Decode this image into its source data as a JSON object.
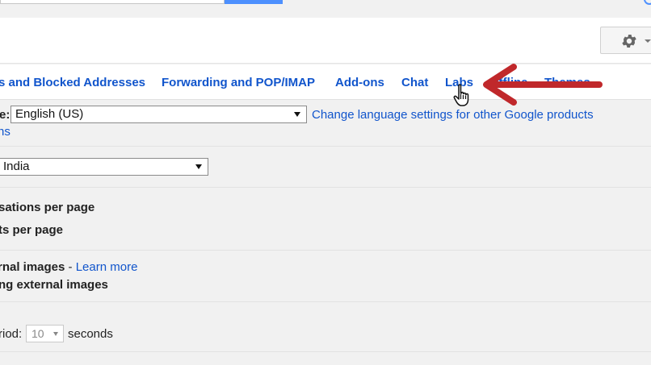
{
  "tabs": [
    {
      "label": "s and Blocked Addresses"
    },
    {
      "label": "Forwarding and POP/IMAP"
    },
    {
      "label": "Add-ons"
    },
    {
      "label": "Chat"
    },
    {
      "label": "Labs"
    },
    {
      "label": "Offline"
    },
    {
      "label": "Themes"
    }
  ],
  "language": {
    "label": "e:",
    "selected": "English (US)",
    "change_link": "Change language settings for other Google products",
    "second_line": "ns"
  },
  "country": {
    "selected": "India"
  },
  "page_size": {
    "conversations": "sations per page",
    "contacts": "ts per page"
  },
  "images": {
    "label": "rnal images",
    "separator": " - ",
    "learn_more": "Learn more",
    "option": "ng external images"
  },
  "undo_send": {
    "label": "riod:",
    "selected": "10",
    "unit": "seconds"
  },
  "colors": {
    "link": "#1155cc",
    "arrow": "#c0282b",
    "blue": "#4d90fe"
  },
  "icons": [
    "gear-icon",
    "chevron-down-icon",
    "red-arrow-icon",
    "hand-pointer-icon"
  ]
}
